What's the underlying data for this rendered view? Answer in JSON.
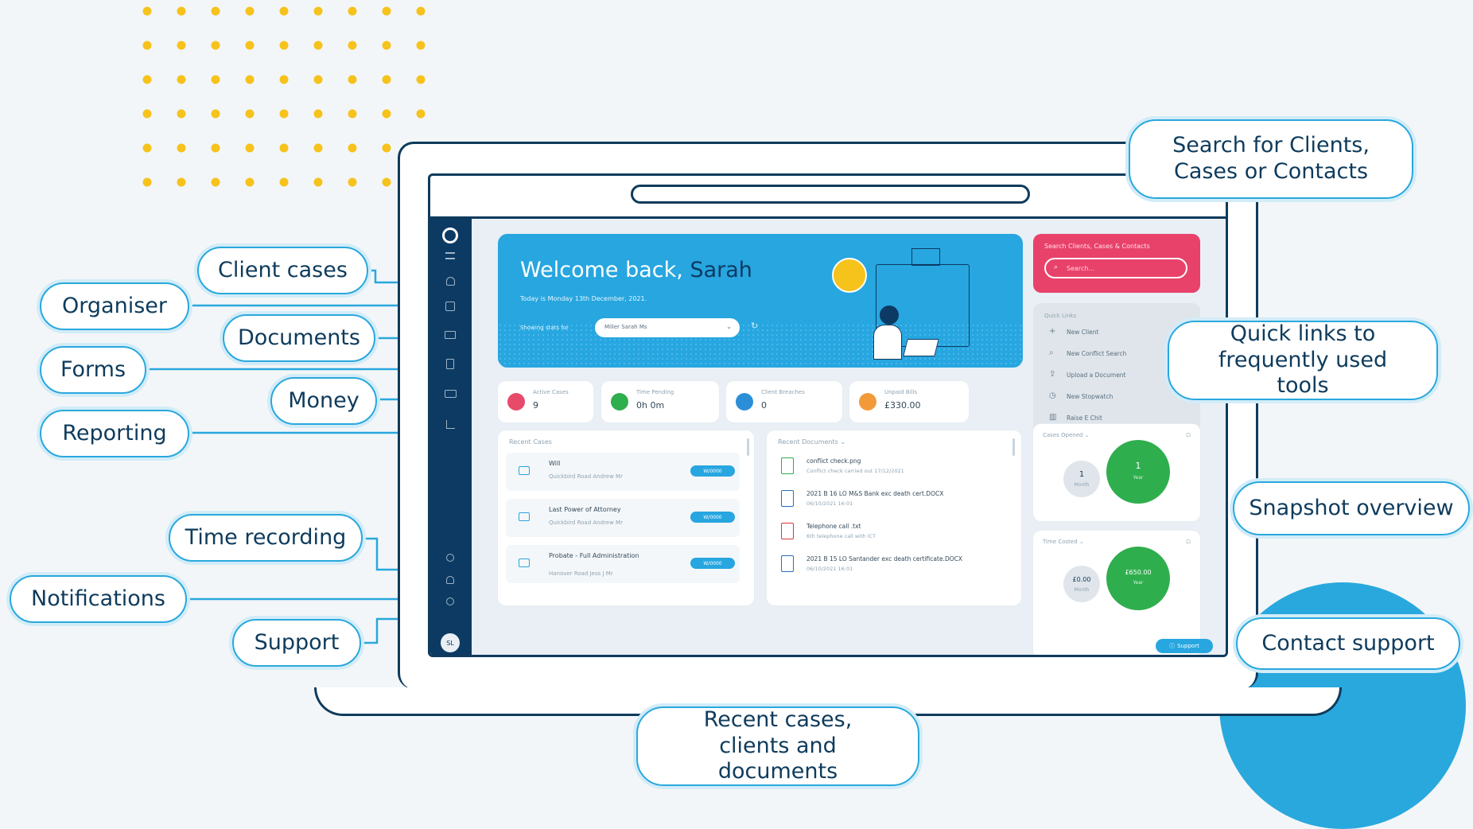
{
  "callouts": {
    "client_cases": "Client cases",
    "organiser": "Organiser",
    "documents": "Documents",
    "forms": "Forms",
    "money": "Money",
    "reporting": "Reporting",
    "time_recording": "Time recording",
    "notifications": "Notifications",
    "support": "Support",
    "search": "Search for Clients, Cases or Contacts",
    "quick_links": "Quick links to frequently used tools",
    "snapshot": "Snapshot overview",
    "contact_support": "Contact support",
    "recent": "Recent cases, clients and documents"
  },
  "app": {
    "welcome": "Welcome back,",
    "user_name": "Sarah",
    "date_line": "Today is Monday 13th December, 2021.",
    "showing_label": "Showing stats for",
    "showing_value": "Miller Sarah Ms",
    "search_title": "Search Clients, Cases & Contacts",
    "search_placeholder": "Search...",
    "quick_links_title": "Quick Links",
    "quick_links": [
      {
        "label": "New Client",
        "icon": "plus-icon"
      },
      {
        "label": "New Conflict Search",
        "icon": "search-icon"
      },
      {
        "label": "Upload a Document",
        "icon": "upload-icon"
      },
      {
        "label": "New Stopwatch",
        "icon": "stopwatch-icon"
      },
      {
        "label": "Raise E Chit",
        "icon": "chart-icon"
      }
    ],
    "stats": [
      {
        "label": "Active Cases",
        "value": "9",
        "color": "#e84a6a"
      },
      {
        "label": "Time Pending",
        "value": "0h 0m",
        "color": "#2fae4e"
      },
      {
        "label": "Client Breaches",
        "value": "0",
        "color": "#2a8fd6"
      },
      {
        "label": "Unpaid Bills",
        "value": "£330.00",
        "color": "#f29a3a"
      }
    ],
    "recent_cases_title": "Recent Cases",
    "recent_cases": [
      {
        "title": "Will",
        "sub": "Quickbird Road Andrew Mr",
        "badge": "W/0000"
      },
      {
        "title": "Last Power of Attorney",
        "sub": "Quickbird Road Andrew Mr",
        "badge": "W/0000"
      },
      {
        "title": "Probate - Full Administration",
        "sub": "Hanover Road Jess J Mr",
        "badge": "W/0000"
      }
    ],
    "recent_docs_title": "Recent Documents",
    "recent_docs": [
      {
        "name": "conflict check.png",
        "sub": "Conflict check carried out 17/12/2021",
        "color": "#2fae4e"
      },
      {
        "name": "2021 B 16 LO M&S Bank exc death cert.DOCX",
        "sub": "06/10/2021 16:01",
        "color": "#2a6fb8"
      },
      {
        "name": "Telephone call .txt",
        "sub": "6th telephone call with ICT",
        "color": "#d9363e"
      },
      {
        "name": "2021 B 15 LO Santander exc death certificate.DOCX",
        "sub": "06/10/2021 16:01",
        "color": "#2a6fb8"
      }
    ],
    "cases_opened_title": "Cases Opened",
    "cases_opened": {
      "month": "1",
      "year": "1",
      "month_label": "Month",
      "year_label": "Year"
    },
    "time_costed_title": "Time Costed",
    "time_costed": {
      "month": "£0.00",
      "year": "£650.00",
      "month_label": "Month",
      "year_label": "Year"
    },
    "support_button": "Support",
    "avatar_initials": "SL"
  },
  "colors": {
    "accent_blue": "#29a8dd",
    "navy": "#0e3b5c",
    "search_pink": "#e8426a",
    "green": "#2fae4e",
    "dot_yellow": "#f6c21c"
  }
}
